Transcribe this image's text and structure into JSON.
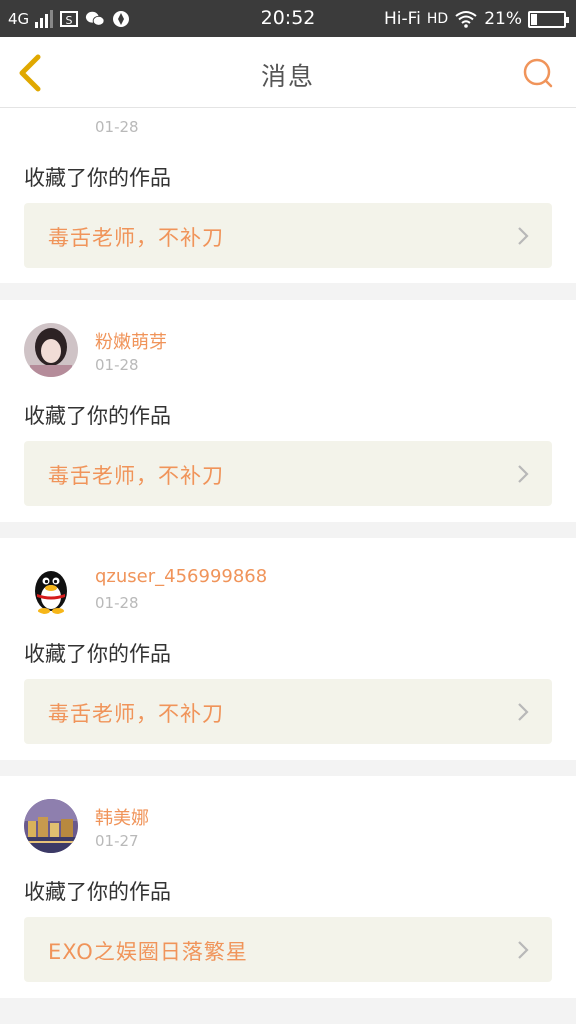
{
  "status_bar": {
    "network": "4G",
    "time": "20:52",
    "wifi_label": "Hi-Fi",
    "hd_label": "HD",
    "battery": "21%",
    "battery_level": 0.21
  },
  "header": {
    "title": "消息",
    "back_icon": "chevron-left-icon",
    "search_icon": "search-icon"
  },
  "colors": {
    "accent": "#f0945a",
    "back_icon": "#e0a800",
    "work_box_bg": "#f3f3ea"
  },
  "messages": [
    {
      "date": "01-28",
      "action": "收藏了你的作品",
      "work_title": "毒舌老师，不补刀"
    },
    {
      "username": "粉嫩萌芽",
      "date": "01-28",
      "action": "收藏了你的作品",
      "work_title": "毒舌老师，不补刀"
    },
    {
      "username": "qzuser_456999868",
      "date": "01-28",
      "action": "收藏了你的作品",
      "work_title": "毒舌老师，不补刀"
    },
    {
      "username": "韩美娜",
      "date": "01-27",
      "action": "收藏了你的作品",
      "work_title": "EXO之娱圈日落繁星"
    }
  ]
}
